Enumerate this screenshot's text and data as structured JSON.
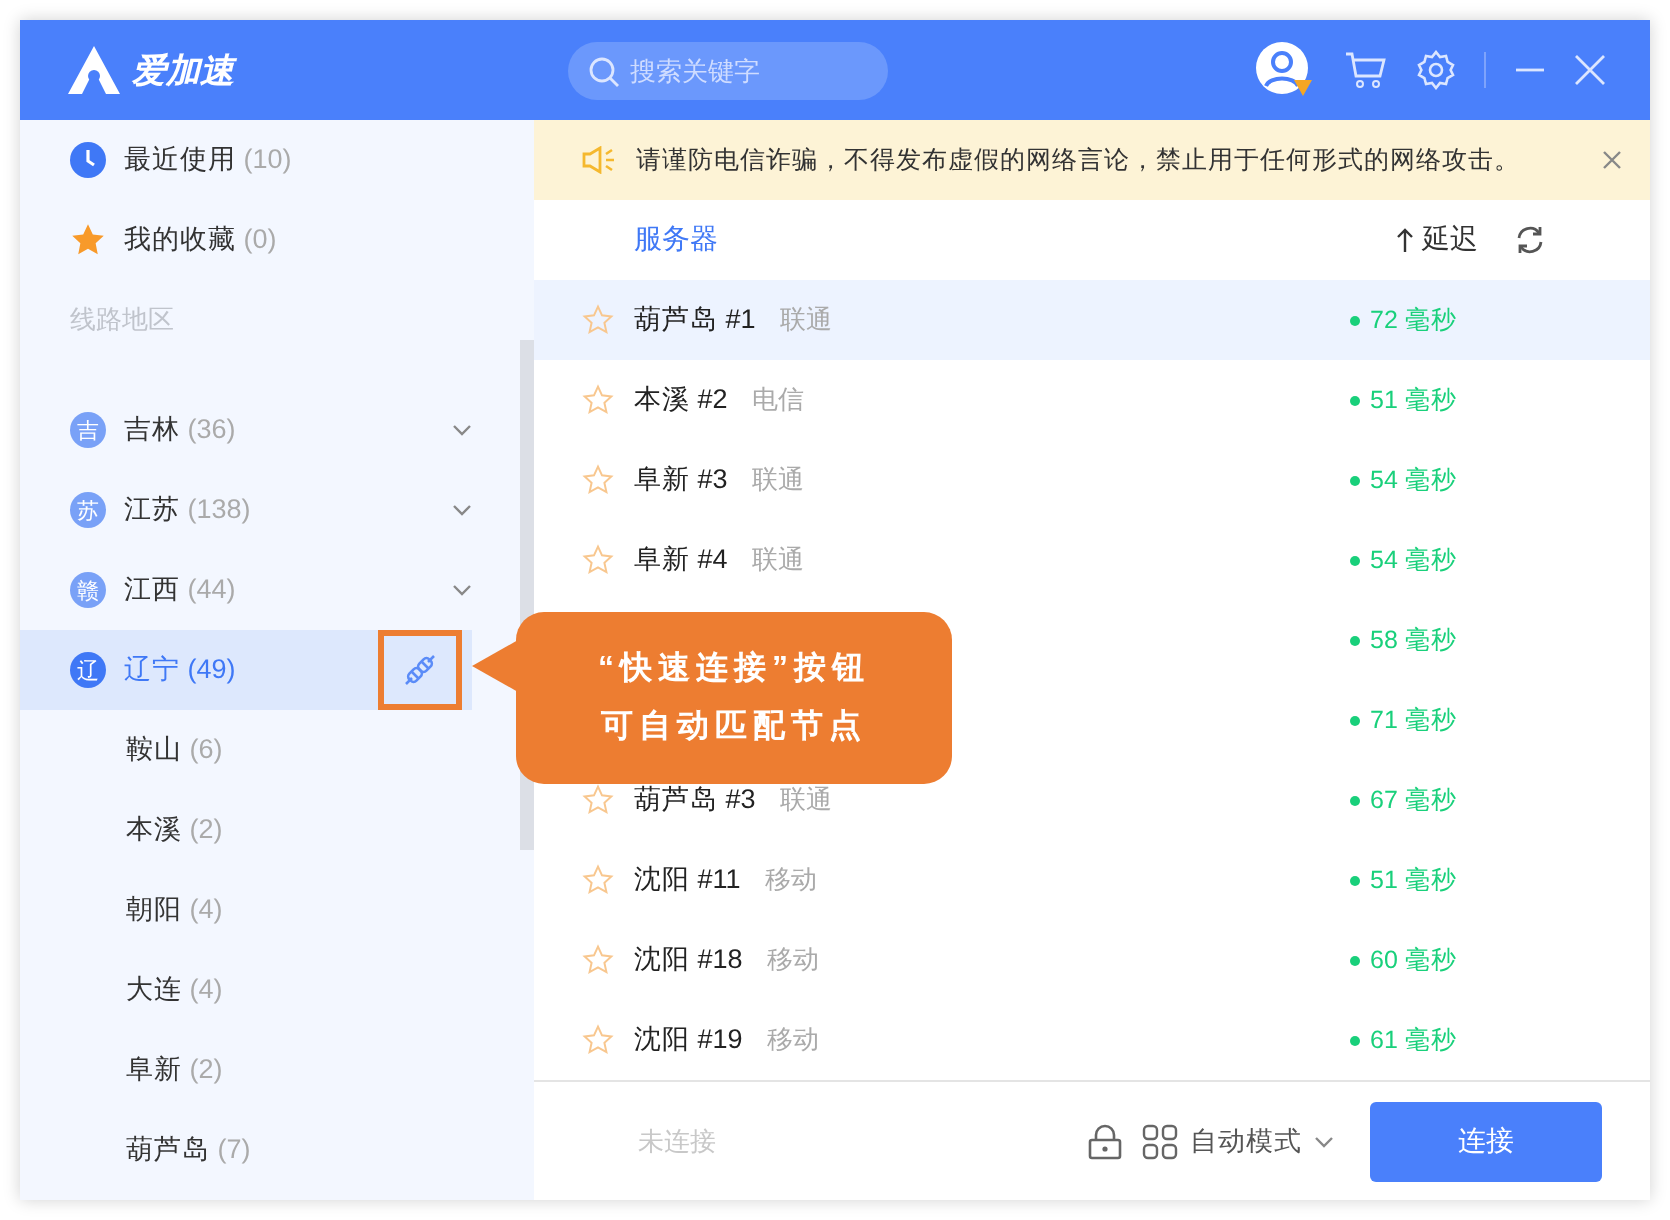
{
  "app": {
    "name": "爱加速"
  },
  "search": {
    "placeholder": "搜索关键字"
  },
  "sidebar": {
    "top_items": [
      {
        "kind": "recent",
        "label": "最近使用",
        "count": "(10)"
      },
      {
        "kind": "favorite",
        "label": "我的收藏",
        "count": "(0)"
      }
    ],
    "section_title": "线路地区",
    "regions": [
      {
        "badge": "吉",
        "name": "吉林",
        "count": "(36)",
        "expanded": false,
        "selected": false
      },
      {
        "badge": "苏",
        "name": "江苏",
        "count": "(138)",
        "expanded": false,
        "selected": false
      },
      {
        "badge": "赣",
        "name": "江西",
        "count": "(44)",
        "expanded": false,
        "selected": false
      },
      {
        "badge": "辽",
        "name": "辽宁",
        "count": "(49)",
        "expanded": true,
        "selected": true,
        "children": [
          {
            "name": "鞍山",
            "count": "(6)"
          },
          {
            "name": "本溪",
            "count": "(2)"
          },
          {
            "name": "朝阳",
            "count": "(4)"
          },
          {
            "name": "大连",
            "count": "(4)"
          },
          {
            "name": "阜新",
            "count": "(2)"
          },
          {
            "name": "葫芦岛",
            "count": "(7)"
          }
        ]
      }
    ]
  },
  "notice": {
    "text": "请谨防电信诈骗，不得发布虚假的网络言论，禁止用于任何形式的网络攻击。"
  },
  "table": {
    "columns": [
      "服务器",
      "延迟"
    ],
    "rows": [
      {
        "name": "葫芦岛 #1",
        "carrier": "联通",
        "latency": "72 毫秒",
        "selected": true
      },
      {
        "name": "本溪 #2",
        "carrier": "电信",
        "latency": "51 毫秒",
        "selected": false
      },
      {
        "name": "阜新 #3",
        "carrier": "联通",
        "latency": "54 毫秒",
        "selected": false
      },
      {
        "name": "阜新 #4",
        "carrier": "联通",
        "latency": "54 毫秒",
        "selected": false
      },
      {
        "latency": "58 毫秒",
        "selected": false
      },
      {
        "latency": "71 毫秒",
        "selected": false
      },
      {
        "name": "葫芦岛 #3",
        "carrier": "联通",
        "latency": "67 毫秒",
        "selected": false
      },
      {
        "name": "沈阳 #11",
        "carrier": "移动",
        "latency": "51 毫秒",
        "selected": false
      },
      {
        "name": "沈阳 #18",
        "carrier": "移动",
        "latency": "60 毫秒",
        "selected": false
      },
      {
        "name": "沈阳 #19",
        "carrier": "移动",
        "latency": "61 毫秒",
        "selected": false
      }
    ]
  },
  "footer": {
    "status": "未连接",
    "mode": "自动模式",
    "connect_button": "连接"
  },
  "callout": {
    "lines": [
      "“快速连接”按钮",
      "可自动匹配节点"
    ]
  }
}
